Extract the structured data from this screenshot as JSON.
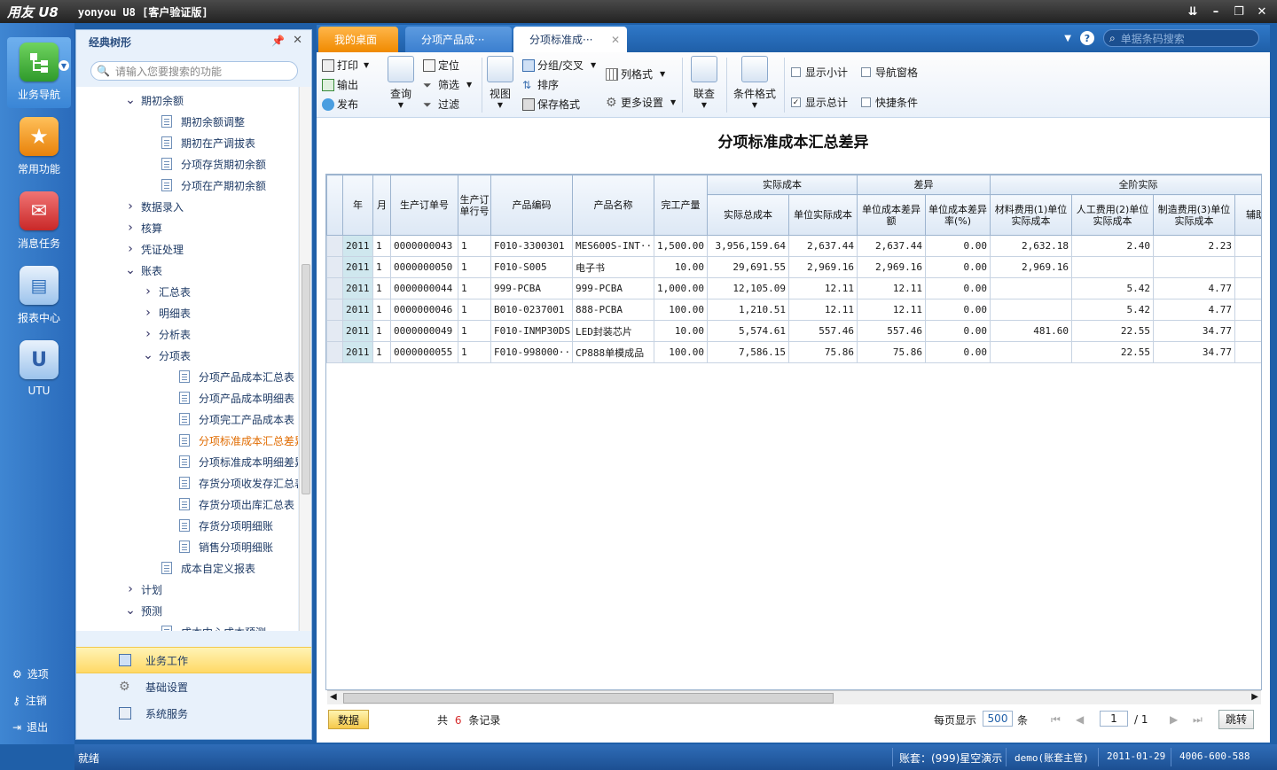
{
  "window": {
    "logo": "用友 U8",
    "title": "yonyou U8 [客户验证版]",
    "btns": [
      "⇊",
      "–",
      "❐",
      "✕"
    ]
  },
  "leftbar": {
    "items": [
      {
        "label": "业务导航",
        "icon": "business-nav-icon",
        "color": "#3aa835"
      },
      {
        "label": "常用功能",
        "icon": "star-icon",
        "color": "#f08a00"
      },
      {
        "label": "消息任务",
        "icon": "mail-icon",
        "color": "#d93c3c"
      },
      {
        "label": "报表中心",
        "icon": "report-icon",
        "color": "#4a90d9"
      },
      {
        "label": "UTU",
        "icon": "utu-icon",
        "color": "#3c6fb8"
      }
    ],
    "bottom": [
      {
        "label": "选项",
        "icon": "gear-icon"
      },
      {
        "label": "注销",
        "icon": "key-icon"
      },
      {
        "label": "退出",
        "icon": "exit-icon"
      }
    ]
  },
  "nav": {
    "title": "经典树形",
    "search_placeholder": "请输入您要搜索的功能",
    "tree": [
      {
        "label": "期初余额",
        "level": 1,
        "type": "open"
      },
      {
        "label": "期初余额调整",
        "level": 2,
        "type": "doc"
      },
      {
        "label": "期初在产调拔表",
        "level": 2,
        "type": "doc"
      },
      {
        "label": "分项存货期初余额",
        "level": 2,
        "type": "doc"
      },
      {
        "label": "分项在产期初余额",
        "level": 2,
        "type": "doc"
      },
      {
        "label": "数据录入",
        "level": 1,
        "type": "closed"
      },
      {
        "label": "核算",
        "level": 1,
        "type": "closed"
      },
      {
        "label": "凭证处理",
        "level": 1,
        "type": "closed"
      },
      {
        "label": "账表",
        "level": 1,
        "type": "open"
      },
      {
        "label": "汇总表",
        "level": 2,
        "type": "closed"
      },
      {
        "label": "明细表",
        "level": 2,
        "type": "closed"
      },
      {
        "label": "分析表",
        "level": 2,
        "type": "closed"
      },
      {
        "label": "分项表",
        "level": 2,
        "type": "open"
      },
      {
        "label": "分项产品成本汇总表",
        "level": 3,
        "type": "doc"
      },
      {
        "label": "分项产品成本明细表",
        "level": 3,
        "type": "doc"
      },
      {
        "label": "分项完工产品成本表",
        "level": 3,
        "type": "doc"
      },
      {
        "label": "分项标准成本汇总差异",
        "level": 3,
        "type": "doc",
        "selected": true
      },
      {
        "label": "分项标准成本明细差异",
        "level": 3,
        "type": "doc"
      },
      {
        "label": "存货分项收发存汇总表",
        "level": 3,
        "type": "doc"
      },
      {
        "label": "存货分项出库汇总表",
        "level": 3,
        "type": "doc"
      },
      {
        "label": "存货分项明细账",
        "level": 3,
        "type": "doc"
      },
      {
        "label": "销售分项明细账",
        "level": 3,
        "type": "doc"
      },
      {
        "label": "成本自定义报表",
        "level": 2,
        "type": "doc"
      },
      {
        "label": "计划",
        "level": 1,
        "type": "closed"
      },
      {
        "label": "预测",
        "level": 1,
        "type": "open"
      },
      {
        "label": "成本中心成本预测",
        "level": 2,
        "type": "doc"
      }
    ],
    "footer": [
      {
        "label": "业务工作",
        "active": true
      },
      {
        "label": "基础设置",
        "active": false
      },
      {
        "label": "系统服务",
        "active": false
      }
    ]
  },
  "tabs": {
    "home": "我的桌面",
    "t2": "分项产品成···",
    "t3": "分项标准成···",
    "search_placeholder": "单据条码搜索"
  },
  "toolbar": {
    "print": "打印",
    "export": "输出",
    "publish": "发布",
    "query": "查询",
    "locate": "定位",
    "filter": "筛选",
    "filter2": "过滤",
    "view": "视图",
    "group": "分组/交叉",
    "sort": "排序",
    "save_format": "保存格式",
    "column_format": "列格式",
    "more_settings": "更多设置",
    "link": "联查",
    "cond_format": "条件格式",
    "show_subtotal": "显示小计",
    "show_total": "显示总计",
    "nav_pane": "导航窗格",
    "quick_cond": "快捷条件"
  },
  "report": {
    "title": "分项标准成本汇总差异",
    "groups": {
      "actual": "实际成本",
      "diff": "差异",
      "full": "全阶实际"
    },
    "headers": {
      "year": "年",
      "month": "月",
      "order": "生产订单号",
      "line": "生产订单行号",
      "code": "产品编码",
      "name": "产品名称",
      "qty": "完工产量",
      "total": "实际总成本",
      "unit": "单位实际成本",
      "udiff": "单位成本差异额",
      "rate": "单位成本差异率(%)",
      "mat": "材料费用(1)单位实际成本",
      "labor": "人工费用(2)单位实际成本",
      "mfg": "制造费用(3)单位实际成本",
      "aux": "辅助位"
    },
    "rows": [
      [
        "2011",
        "1",
        "0000000043",
        "1",
        "F010-3300301",
        "MES600S-INT···",
        "1,500.00",
        "3,956,159.64",
        "2,637.44",
        "2,637.44",
        "0.00",
        "2,632.18",
        "2.40",
        "2.23"
      ],
      [
        "2011",
        "1",
        "0000000050",
        "1",
        "F010-S005",
        "电子书",
        "10.00",
        "29,691.55",
        "2,969.16",
        "2,969.16",
        "0.00",
        "2,969.16",
        "",
        ""
      ],
      [
        "2011",
        "1",
        "0000000044",
        "1",
        "999-PCBA",
        "999-PCBA",
        "1,000.00",
        "12,105.09",
        "12.11",
        "12.11",
        "0.00",
        "",
        "5.42",
        "4.77"
      ],
      [
        "2011",
        "1",
        "0000000046",
        "1",
        "B010-0237001",
        "888-PCBA",
        "100.00",
        "1,210.51",
        "12.11",
        "12.11",
        "0.00",
        "",
        "5.42",
        "4.77"
      ],
      [
        "2011",
        "1",
        "0000000049",
        "1",
        "F010-INMP30DS",
        "LED封装芯片",
        "10.00",
        "5,574.61",
        "557.46",
        "557.46",
        "0.00",
        "481.60",
        "22.55",
        "34.77"
      ],
      [
        "2011",
        "1",
        "0000000055",
        "1",
        "F010-998000···",
        "CP888单模成品",
        "100.00",
        "7,586.15",
        "75.86",
        "75.86",
        "0.00",
        "",
        "22.55",
        "34.77"
      ]
    ]
  },
  "bottom": {
    "data_btn": "数据",
    "total_prefix": "共",
    "total_count": "6",
    "total_suffix": "条记录",
    "per_page_label": "每页显示",
    "per_page": "500",
    "per_page_unit": "条",
    "page": "1",
    "page_total": "/ 1",
    "jump": "跳转"
  },
  "status": {
    "ready": "就绪",
    "account": "账套：(999)星空演示",
    "user": "demo(账套主管)",
    "date": "2011-01-29",
    "phone": "4006-600-588"
  }
}
